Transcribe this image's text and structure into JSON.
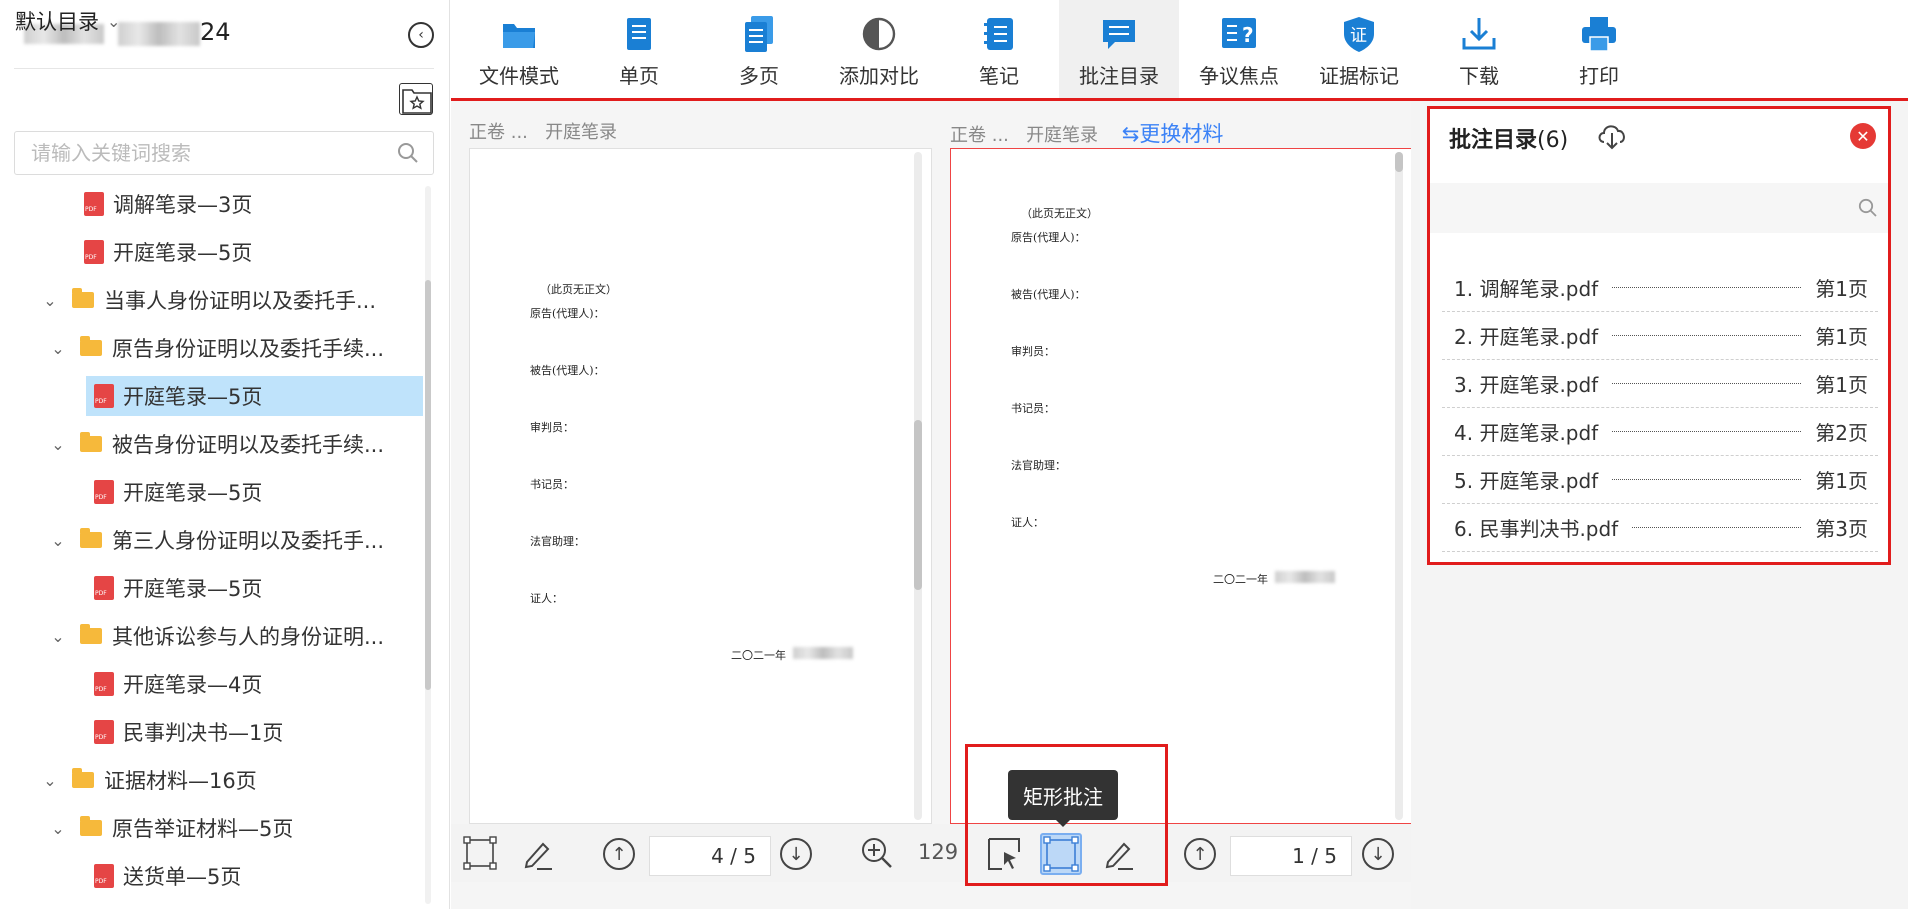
{
  "sidebar": {
    "user_suffix": "24",
    "collapse_icon": "back-circle-icon",
    "directory_label": "默认目录",
    "search": {
      "placeholder": "请输入关键词搜索",
      "value": ""
    },
    "tree": [
      {
        "type": "file",
        "label": "调解笔录—3页",
        "level": 2
      },
      {
        "type": "file",
        "label": "开庭笔录—5页",
        "level": 2
      },
      {
        "type": "folder",
        "label": "当事人身份证明以及委托手...",
        "level": 1
      },
      {
        "type": "folder",
        "label": "原告身份证明以及委托手续...",
        "level": 2
      },
      {
        "type": "file",
        "label": "开庭笔录—5页",
        "level": 3,
        "selected": true
      },
      {
        "type": "folder",
        "label": "被告身份证明以及委托手续...",
        "level": 2
      },
      {
        "type": "file",
        "label": "开庭笔录—5页",
        "level": 3
      },
      {
        "type": "folder",
        "label": "第三人身份证明以及委托手...",
        "level": 2
      },
      {
        "type": "file",
        "label": "开庭笔录—5页",
        "level": 3
      },
      {
        "type": "folder",
        "label": "其他诉讼参与人的身份证明...",
        "level": 2
      },
      {
        "type": "file",
        "label": "开庭笔录—4页",
        "level": 3
      },
      {
        "type": "file",
        "label": "民事判决书—1页",
        "level": 3
      },
      {
        "type": "folder",
        "label": "证据材料—16页",
        "level": 1
      },
      {
        "type": "folder",
        "label": "原告举证材料—5页",
        "level": 2
      },
      {
        "type": "file",
        "label": "送货单—5页",
        "level": 3
      }
    ]
  },
  "toolbar": {
    "items": [
      {
        "label": "文件模式",
        "icon": "folder-icon"
      },
      {
        "label": "单页",
        "icon": "single-page-icon"
      },
      {
        "label": "多页",
        "icon": "multi-page-icon"
      },
      {
        "label": "添加对比",
        "icon": "compare-icon"
      },
      {
        "label": "笔记",
        "icon": "notebook-icon"
      },
      {
        "label": "批注目录",
        "icon": "comment-list-icon",
        "active": true
      },
      {
        "label": "争议焦点",
        "icon": "dispute-focus-icon"
      },
      {
        "label": "证据标记",
        "icon": "evidence-badge-icon"
      },
      {
        "label": "下载",
        "icon": "download-icon"
      },
      {
        "label": "打印",
        "icon": "printer-icon"
      }
    ]
  },
  "left_pane": {
    "crumb_a": "正卷 ...",
    "crumb_b": "开庭笔录",
    "doc_lines": [
      "（此页无正文）",
      "原告(代理人)：",
      "被告(代理人)：",
      "审判员：",
      "书记员：",
      "法官助理：",
      "证人：",
      "二〇二一年"
    ],
    "page_value": "4 / 5",
    "zoom_text": "129"
  },
  "right_pane": {
    "crumb_a": "正卷 ...",
    "crumb_b": "开庭笔录",
    "swap_link": "⇆更换材料",
    "doc_lines": [
      "（此页无正文）",
      "原告(代理人)：",
      "被告(代理人)：",
      "审判员：",
      "书记员：",
      "法官助理：",
      "证人：",
      "二〇二一年"
    ],
    "page_value": "1 / 5",
    "tooltip": "矩形批注"
  },
  "annotations": {
    "title": "批注目录",
    "count": "(6)",
    "search": {
      "placeholder": "",
      "value": ""
    },
    "items": [
      {
        "name": "1. 调解笔录.pdf",
        "page": "第1页"
      },
      {
        "name": "2. 开庭笔录.pdf",
        "page": "第1页"
      },
      {
        "name": "3. 开庭笔录.pdf",
        "page": "第1页"
      },
      {
        "name": "4. 开庭笔录.pdf",
        "page": "第2页"
      },
      {
        "name": "5. 开庭笔录.pdf",
        "page": "第1页"
      },
      {
        "name": "6. 民事判决书.pdf",
        "page": "第3页"
      }
    ]
  },
  "colors": {
    "accent": "#1a7fd4",
    "highlight_red": "#e11c1c",
    "selected_row": "#bfe3fb",
    "folder": "#f6b93b",
    "pdf": "#e54545"
  }
}
